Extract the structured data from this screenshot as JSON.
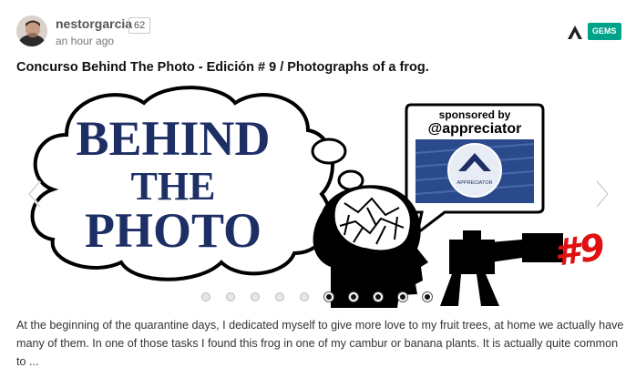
{
  "post": {
    "author": "nestorgarcia",
    "reputation": "62",
    "time": "an hour ago",
    "badge": "GEMS",
    "title": "Concurso Behind The Photo - Edición # 9 / Photographs of a frog.",
    "excerpt": "At the beginning of the quarantine days, I dedicated myself to give more love to my fruit trees, at home we actually have many of them. In one of those tasks I found this frog in one of my cambur or banana plants. It is actually quite common to ..."
  },
  "banner": {
    "line1": "BEHIND",
    "line2": "THE",
    "line3": "PHOTO",
    "sponsored_label": "sponsored by",
    "sponsor_handle": "@appreciator",
    "logo_text": "APPRECIATOR",
    "edition": "#9"
  },
  "carousel": {
    "slide_count": 10,
    "active_indices": [
      5,
      6,
      7,
      8,
      9
    ]
  },
  "icons": {
    "prev": "chevron-left-icon",
    "next": "chevron-right-icon",
    "app": "app-logo-icon"
  },
  "colors": {
    "badge": "#00a38a",
    "banner_text": "#1e2f66",
    "edition": "#e01010"
  }
}
